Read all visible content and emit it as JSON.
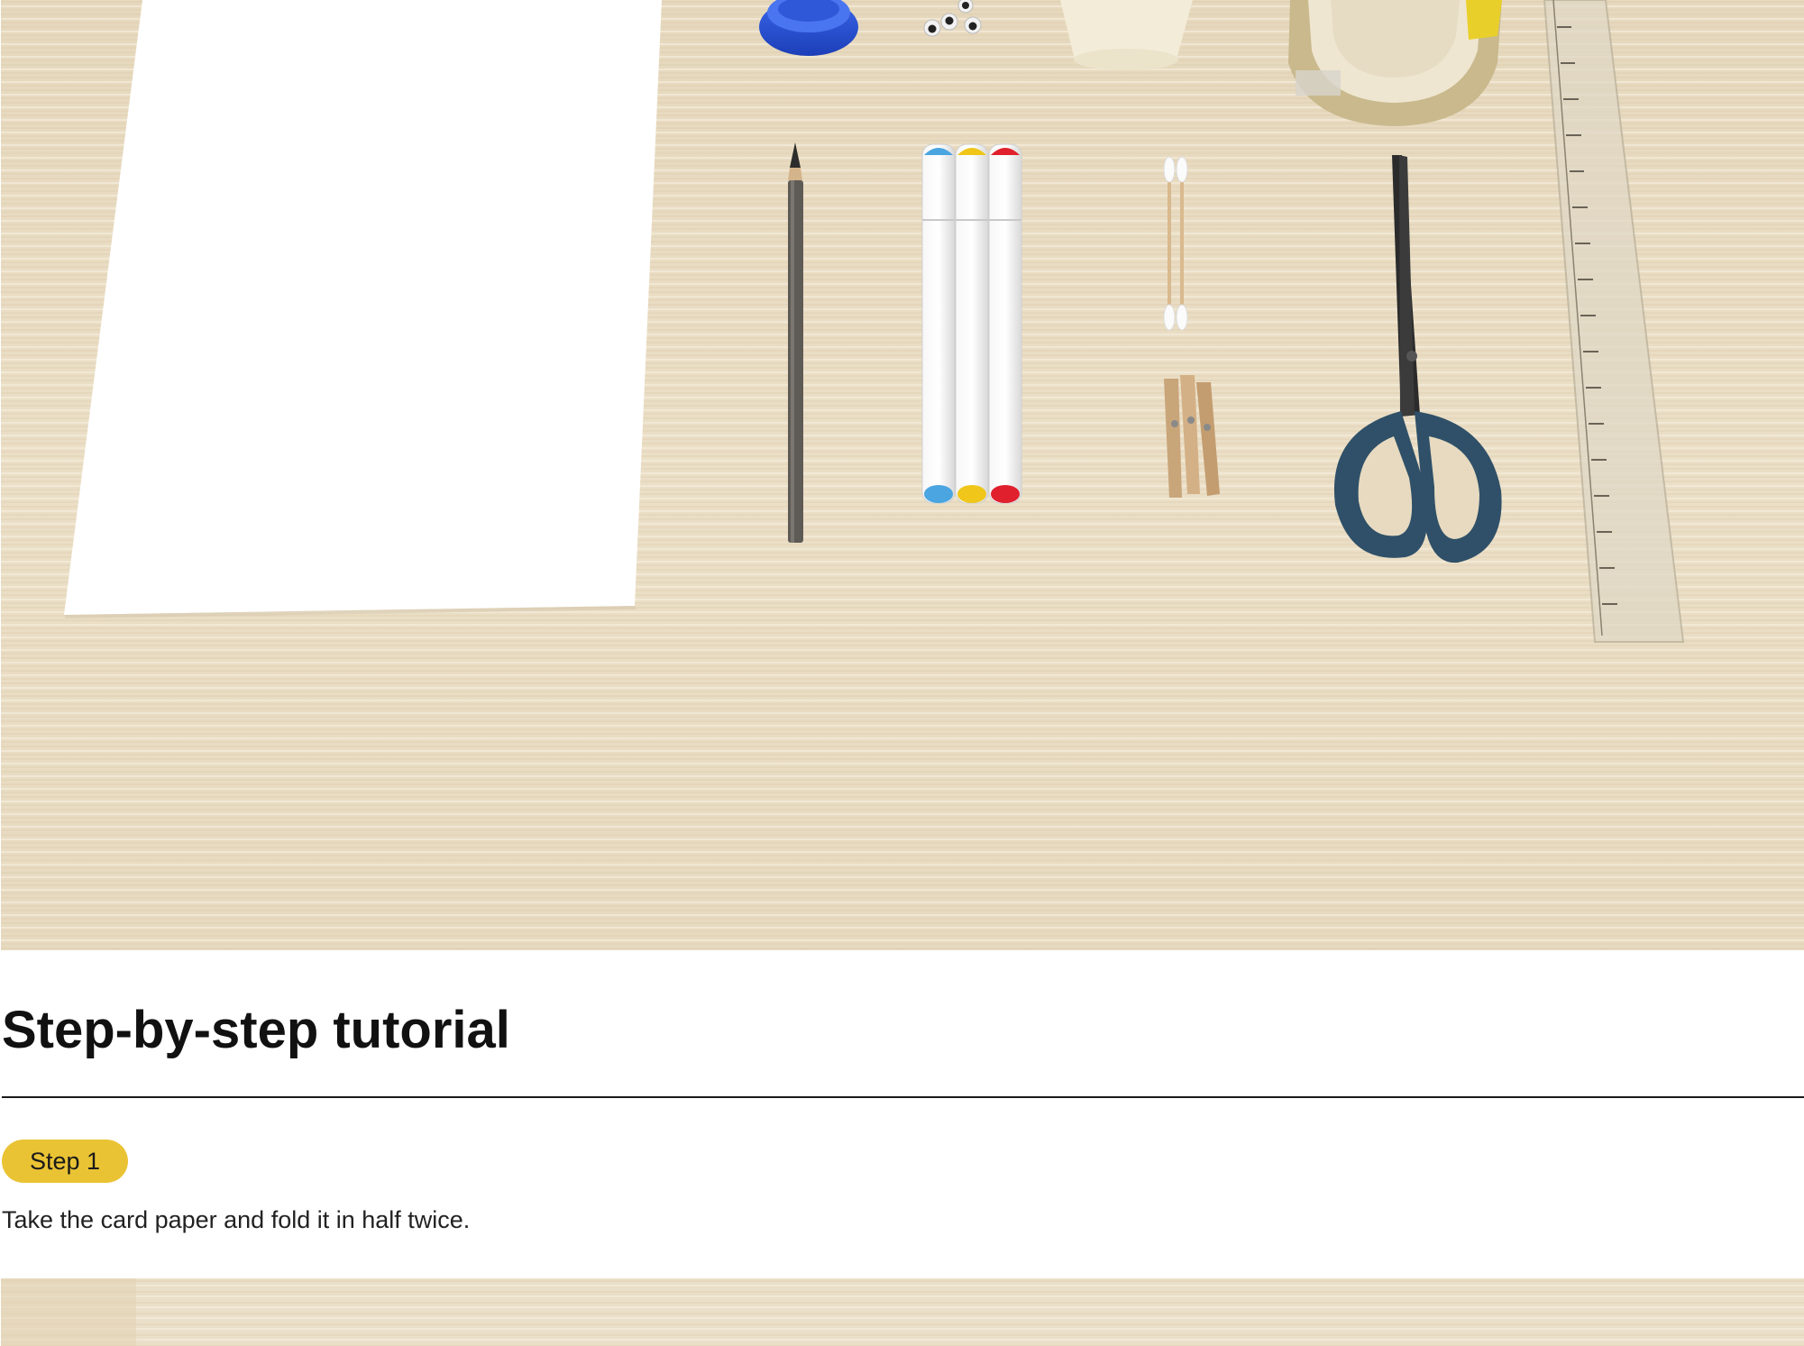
{
  "hero_image": {
    "subject": "craft-materials-on-wooden-table",
    "items": [
      "card-paper",
      "bottle-cap",
      "googly-eyes",
      "paper-cup",
      "tape-roll",
      "ruler",
      "pencil",
      "markers",
      "cotton-swabs",
      "clothespins",
      "scissors"
    ],
    "colors": {
      "wood": "#e9dcc2",
      "paper": "#ffffff",
      "cap": "#2f56d6",
      "scissors": "#2f5068",
      "marker_blue": "#4aa5e0",
      "marker_yellow": "#efc619",
      "marker_red": "#e0202c"
    }
  },
  "tutorial": {
    "title": "Step-by-step tutorial",
    "steps": [
      {
        "badge": "Step 1",
        "text": "Take the card paper and fold it in half twice."
      }
    ]
  },
  "theme": {
    "badge_color": "#eac334",
    "divider_color": "#1a1a1a",
    "text_color": "#111111"
  }
}
